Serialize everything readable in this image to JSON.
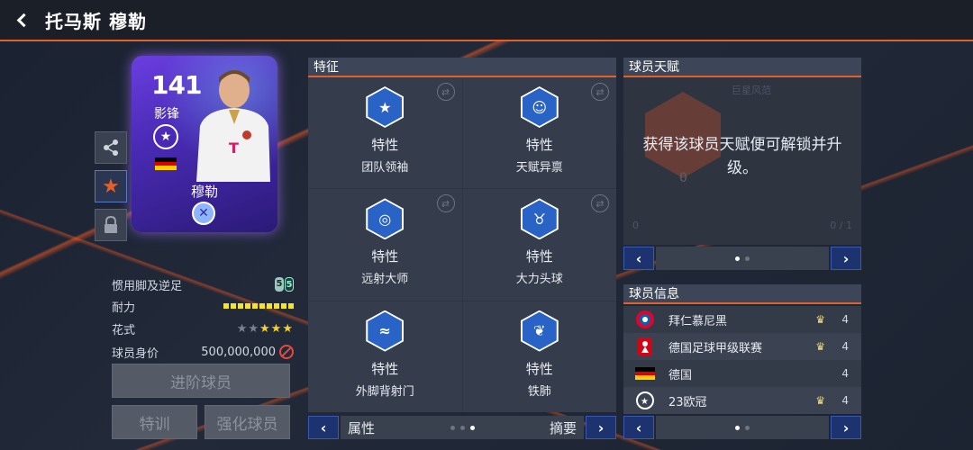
{
  "header": {
    "title": "托马斯 穆勒"
  },
  "card": {
    "rating": "141",
    "position": "影锋",
    "name": "穆勒"
  },
  "stats": {
    "weak_foot_label": "惯用脚及逆足",
    "weak_foot_left": "5",
    "weak_foot_right": "5",
    "stamina_label": "耐力",
    "skill_label": "花式",
    "skill_stars_filled": 3,
    "skill_stars_total": 5,
    "value_label": "球员身价",
    "value": "500,000,000"
  },
  "buttons": {
    "upgrade": "进阶球员",
    "training": "特训",
    "enhance": "强化球员"
  },
  "traits_panel": {
    "title": "特征",
    "items": [
      {
        "title": "特性",
        "name": "团队领袖",
        "icon": "star-chevron-icon"
      },
      {
        "title": "特性",
        "name": "天赋异禀",
        "icon": "brain-head-icon"
      },
      {
        "title": "特性",
        "name": "远射大师",
        "icon": "target-ball-icon"
      },
      {
        "title": "特性",
        "name": "大力头球",
        "icon": "bull-icon"
      },
      {
        "title": "特性",
        "name": "外脚背射门",
        "icon": "curve-shot-icon"
      },
      {
        "title": "特性",
        "name": "铁肺",
        "icon": "lungs-icon"
      }
    ],
    "pager_left": "属性",
    "pager_right": "摘要"
  },
  "talent_panel": {
    "title": "球员天赋",
    "background_label": "巨星风范",
    "background_value": "0",
    "background_left": "0",
    "background_count": "0 / 1",
    "message": "获得该球员天赋便可解锁并升级。"
  },
  "info_panel": {
    "title": "球员信息",
    "rows": [
      {
        "name": "拜仁慕尼黑",
        "rating": "4",
        "has_trophy": true
      },
      {
        "name": "德国足球甲级联赛",
        "rating": "4",
        "has_trophy": true
      },
      {
        "name": "德国",
        "rating": "4",
        "has_trophy": false
      },
      {
        "name": "23欧冠",
        "rating": "4",
        "has_trophy": true
      }
    ]
  },
  "colors": {
    "accent": "#e2612a",
    "nav_blue": "#1d3370",
    "trait_blue": "#2a63c6",
    "card_purple": "#4a2bb5"
  }
}
